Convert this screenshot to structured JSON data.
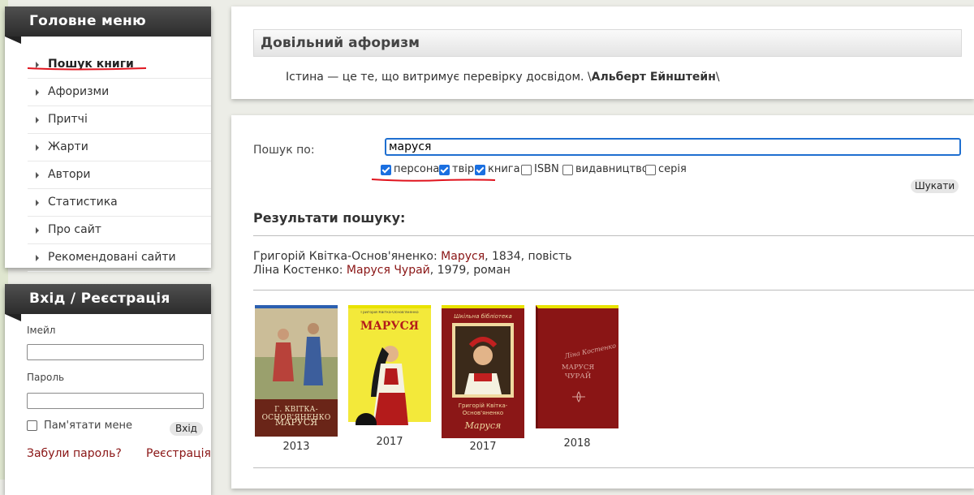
{
  "main_menu": {
    "title": "Головне меню",
    "items": [
      {
        "label": "Пошук книги"
      },
      {
        "label": "Афоризми"
      },
      {
        "label": "Притчі"
      },
      {
        "label": "Жарти"
      },
      {
        "label": "Автори"
      },
      {
        "label": "Статистика"
      },
      {
        "label": "Про сайт"
      },
      {
        "label": "Рекомендовані сайти"
      }
    ]
  },
  "auth": {
    "title": "Вхід / Реєстрація",
    "email_label": "Імейл",
    "password_label": "Пароль",
    "remember_label": "Пам'ятати мене",
    "login_button": "Вхід",
    "forgot_link": "Забули пароль?",
    "register_link": "Реєстрація"
  },
  "aphorism": {
    "title": "Довільний афоризм",
    "text": "Істина — це те, що витримує перевірку досвідом. \\",
    "author": "Альберт Ейнштейн",
    "tail": "\\"
  },
  "search": {
    "label": "Пошук по:",
    "value": "маруся",
    "filters": [
      {
        "label": "персона",
        "checked": true
      },
      {
        "label": "твір",
        "checked": true
      },
      {
        "label": "книга",
        "checked": true
      },
      {
        "label": "ISBN",
        "checked": false
      },
      {
        "label": "видавництво",
        "checked": false
      },
      {
        "label": "серія",
        "checked": false
      }
    ],
    "button": "Шукати"
  },
  "results": {
    "title": "Результати пошуку:",
    "rows": [
      {
        "author": "Григорій Квітка-Основ'яненко: ",
        "work": "Маруся",
        "rest": ", 1834, повість"
      },
      {
        "author": "Ліна Костенко: ",
        "work": "Маруся Чурай",
        "rest": ", 1979, роман"
      }
    ],
    "books": [
      {
        "year": "2013",
        "cover_author": "Г. КВІТКА-ОСНОВ'ЯНЕНКО",
        "cover_title": "МАРУСЯ"
      },
      {
        "year": "2017",
        "cover_author": "Григорій Квітка-Основ'яненко",
        "cover_title": "МАРУСЯ"
      },
      {
        "year": "2017",
        "cover_author": "Григорій Квітка-Основ'яненко",
        "cover_title": "Маруся"
      },
      {
        "year": "2018",
        "cover_author": "Ліна Костенко",
        "cover_title": "МАРУСЯ ЧУРАЙ"
      }
    ]
  },
  "colors": {
    "link": "#8a1515",
    "accent": "#1a6fe0",
    "annotation": "#e0141e"
  }
}
